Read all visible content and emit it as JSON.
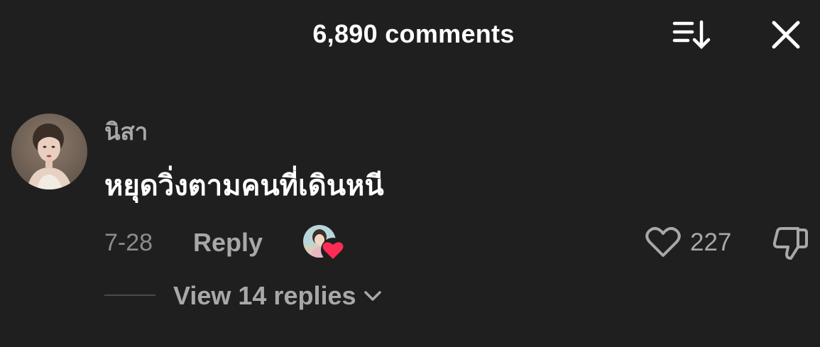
{
  "header": {
    "title": "6,890 comments",
    "sort_icon": "sort-down-icon",
    "close_icon": "close-icon"
  },
  "comment": {
    "username": "นิสา",
    "text": "หยุดวิ่งตามคนที่เดินหนี",
    "date": "7-28",
    "reply_label": "Reply",
    "like_count": "227",
    "view_replies_label": "View 14 replies"
  },
  "colors": {
    "background": "#1f1f1f",
    "heart_badge": "#fe2c55",
    "muted_text": "#a8a8a8"
  }
}
